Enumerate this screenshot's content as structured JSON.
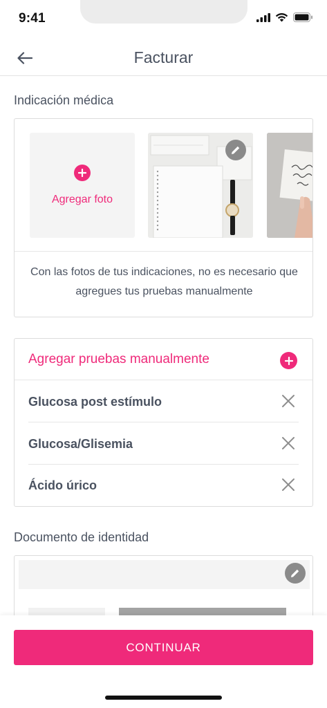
{
  "status_bar": {
    "time": "9:41"
  },
  "header": {
    "title": "Facturar"
  },
  "medical_indication": {
    "label": "Indicación médica",
    "add_photo_label": "Agregar foto",
    "info_text": "Con las fotos de tus indicaciones, no es necesario que agregues tus pruebas manualmente"
  },
  "tests": {
    "add_label": "Agregar pruebas manualmente",
    "items": [
      {
        "label": "Glucosa post estímulo"
      },
      {
        "label": "Glucosa/Glisemia"
      },
      {
        "label": "Ácido úrico"
      }
    ]
  },
  "identity_document": {
    "label": "Documento de identidad"
  },
  "footer": {
    "continue_label": "CONTINUAR"
  },
  "colors": {
    "accent": "#ef2a7a",
    "text": "#4a5260",
    "border": "#dcdcdc"
  }
}
